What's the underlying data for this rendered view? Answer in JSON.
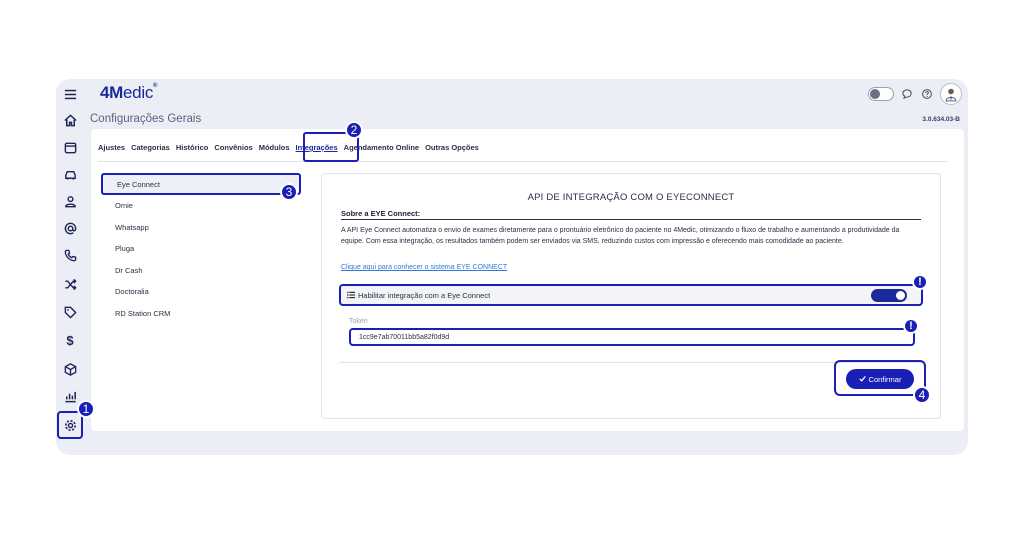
{
  "brand": {
    "logo_main": "4M",
    "logo_rest": "edic"
  },
  "page": {
    "title": "Configurações Gerais",
    "version": "3.0.634.03-B"
  },
  "tabs": [
    "Ajustes",
    "Categorias",
    "Histórico",
    "Convênios",
    "Módulos",
    "Integrações",
    "Agendamento Online",
    "Outras Opções"
  ],
  "active_tab": "Integrações",
  "menu": [
    "Eye Connect",
    "Omie",
    "Whatsapp",
    "Pluga",
    "Dr Cash",
    "Doctoralia",
    "RD Station CRM"
  ],
  "active_menu": "Eye Connect",
  "panel": {
    "title": "API DE INTEGRAÇÃO COM O EYECONNECT",
    "about_title": "Sobre a EYE Connect:",
    "about_text": "A API Eye Connect automatiza o envio de exames diretamente para o prontuário eletrônico do paciente no 4Medic, otimizando o fluxo de trabalho e aumentando a produtividade da equipe. Com essa integração, os resultados também podem ser enviados via SMS, reduzindo custos com impressão e oferecendo mais comodidade ao paciente.",
    "link_text": "Clique aqui para conhecer o sistema EYE CONNECT",
    "enable_label": "Habilitar integração com a Eye Connect",
    "enable_state": true,
    "token_label": "Token",
    "token_value": "1cc9e7ab70011bb5a82f0d9d",
    "confirm_label": "Confirmar"
  },
  "badges": {
    "one": "1",
    "two": "2",
    "three": "3",
    "four": "4",
    "alert": "!"
  },
  "colors": {
    "accent": "#1a1fb5",
    "brand": "#1a2a9c",
    "link": "#2f7bd8"
  },
  "sidebar_icons": [
    "menu-icon",
    "home-icon",
    "calendar-icon",
    "car-icon",
    "user-icon",
    "at-icon",
    "phone-icon",
    "shuffle-icon",
    "tag-icon",
    "dollar-icon",
    "box-icon",
    "chart-icon",
    "settings-icon"
  ]
}
